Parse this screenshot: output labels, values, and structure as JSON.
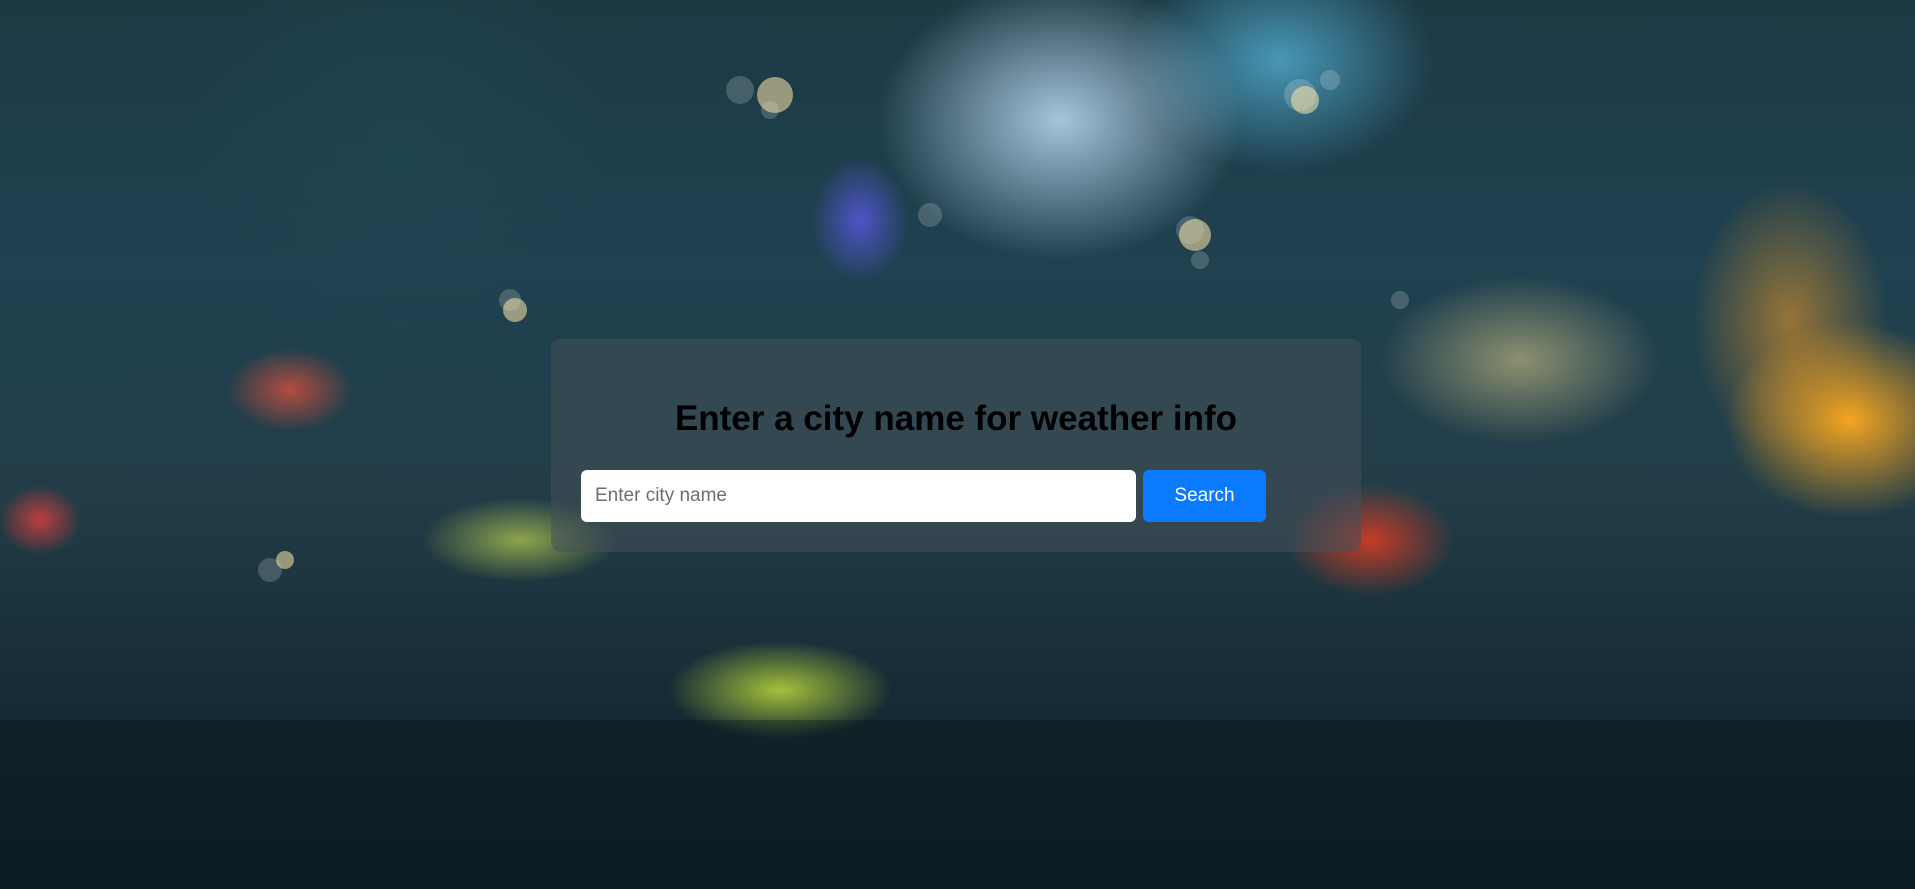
{
  "page": {
    "background_description_icon": "rainy-window-background"
  },
  "weather_card": {
    "title": "Enter a city name for weather info",
    "search": {
      "placeholder": "Enter city name",
      "value": "",
      "button_label": "Search"
    }
  },
  "colors": {
    "button": "#0a7bff",
    "card": "rgba(70,80,90,0.55)",
    "title_text": "#000000"
  }
}
